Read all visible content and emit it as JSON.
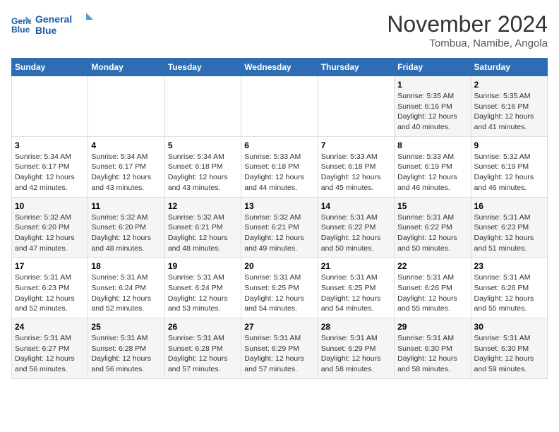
{
  "logo": {
    "line1": "General",
    "line2": "Blue"
  },
  "title": "November 2024",
  "location": "Tombua, Namibe, Angola",
  "weekdays": [
    "Sunday",
    "Monday",
    "Tuesday",
    "Wednesday",
    "Thursday",
    "Friday",
    "Saturday"
  ],
  "weeks": [
    [
      {
        "day": "",
        "info": ""
      },
      {
        "day": "",
        "info": ""
      },
      {
        "day": "",
        "info": ""
      },
      {
        "day": "",
        "info": ""
      },
      {
        "day": "",
        "info": ""
      },
      {
        "day": "1",
        "info": "Sunrise: 5:35 AM\nSunset: 6:16 PM\nDaylight: 12 hours and 40 minutes."
      },
      {
        "day": "2",
        "info": "Sunrise: 5:35 AM\nSunset: 6:16 PM\nDaylight: 12 hours and 41 minutes."
      }
    ],
    [
      {
        "day": "3",
        "info": "Sunrise: 5:34 AM\nSunset: 6:17 PM\nDaylight: 12 hours and 42 minutes."
      },
      {
        "day": "4",
        "info": "Sunrise: 5:34 AM\nSunset: 6:17 PM\nDaylight: 12 hours and 43 minutes."
      },
      {
        "day": "5",
        "info": "Sunrise: 5:34 AM\nSunset: 6:18 PM\nDaylight: 12 hours and 43 minutes."
      },
      {
        "day": "6",
        "info": "Sunrise: 5:33 AM\nSunset: 6:18 PM\nDaylight: 12 hours and 44 minutes."
      },
      {
        "day": "7",
        "info": "Sunrise: 5:33 AM\nSunset: 6:18 PM\nDaylight: 12 hours and 45 minutes."
      },
      {
        "day": "8",
        "info": "Sunrise: 5:33 AM\nSunset: 6:19 PM\nDaylight: 12 hours and 46 minutes."
      },
      {
        "day": "9",
        "info": "Sunrise: 5:32 AM\nSunset: 6:19 PM\nDaylight: 12 hours and 46 minutes."
      }
    ],
    [
      {
        "day": "10",
        "info": "Sunrise: 5:32 AM\nSunset: 6:20 PM\nDaylight: 12 hours and 47 minutes."
      },
      {
        "day": "11",
        "info": "Sunrise: 5:32 AM\nSunset: 6:20 PM\nDaylight: 12 hours and 48 minutes."
      },
      {
        "day": "12",
        "info": "Sunrise: 5:32 AM\nSunset: 6:21 PM\nDaylight: 12 hours and 48 minutes."
      },
      {
        "day": "13",
        "info": "Sunrise: 5:32 AM\nSunset: 6:21 PM\nDaylight: 12 hours and 49 minutes."
      },
      {
        "day": "14",
        "info": "Sunrise: 5:31 AM\nSunset: 6:22 PM\nDaylight: 12 hours and 50 minutes."
      },
      {
        "day": "15",
        "info": "Sunrise: 5:31 AM\nSunset: 6:22 PM\nDaylight: 12 hours and 50 minutes."
      },
      {
        "day": "16",
        "info": "Sunrise: 5:31 AM\nSunset: 6:23 PM\nDaylight: 12 hours and 51 minutes."
      }
    ],
    [
      {
        "day": "17",
        "info": "Sunrise: 5:31 AM\nSunset: 6:23 PM\nDaylight: 12 hours and 52 minutes."
      },
      {
        "day": "18",
        "info": "Sunrise: 5:31 AM\nSunset: 6:24 PM\nDaylight: 12 hours and 52 minutes."
      },
      {
        "day": "19",
        "info": "Sunrise: 5:31 AM\nSunset: 6:24 PM\nDaylight: 12 hours and 53 minutes."
      },
      {
        "day": "20",
        "info": "Sunrise: 5:31 AM\nSunset: 6:25 PM\nDaylight: 12 hours and 54 minutes."
      },
      {
        "day": "21",
        "info": "Sunrise: 5:31 AM\nSunset: 6:25 PM\nDaylight: 12 hours and 54 minutes."
      },
      {
        "day": "22",
        "info": "Sunrise: 5:31 AM\nSunset: 6:26 PM\nDaylight: 12 hours and 55 minutes."
      },
      {
        "day": "23",
        "info": "Sunrise: 5:31 AM\nSunset: 6:26 PM\nDaylight: 12 hours and 55 minutes."
      }
    ],
    [
      {
        "day": "24",
        "info": "Sunrise: 5:31 AM\nSunset: 6:27 PM\nDaylight: 12 hours and 56 minutes."
      },
      {
        "day": "25",
        "info": "Sunrise: 5:31 AM\nSunset: 6:28 PM\nDaylight: 12 hours and 56 minutes."
      },
      {
        "day": "26",
        "info": "Sunrise: 5:31 AM\nSunset: 6:28 PM\nDaylight: 12 hours and 57 minutes."
      },
      {
        "day": "27",
        "info": "Sunrise: 5:31 AM\nSunset: 6:29 PM\nDaylight: 12 hours and 57 minutes."
      },
      {
        "day": "28",
        "info": "Sunrise: 5:31 AM\nSunset: 6:29 PM\nDaylight: 12 hours and 58 minutes."
      },
      {
        "day": "29",
        "info": "Sunrise: 5:31 AM\nSunset: 6:30 PM\nDaylight: 12 hours and 58 minutes."
      },
      {
        "day": "30",
        "info": "Sunrise: 5:31 AM\nSunset: 6:30 PM\nDaylight: 12 hours and 59 minutes."
      }
    ]
  ]
}
